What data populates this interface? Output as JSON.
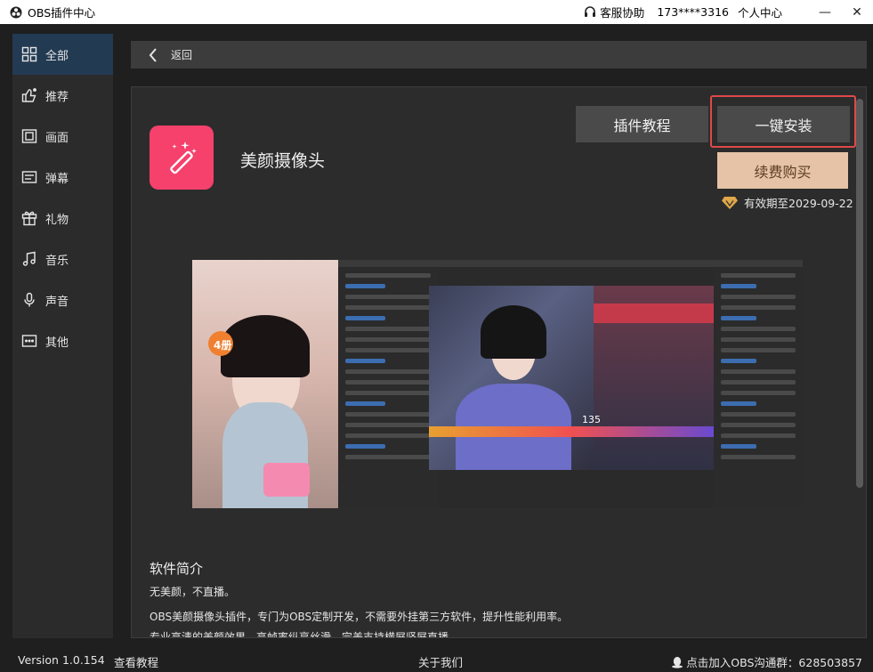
{
  "titlebar": {
    "app_title": "OBS插件中心",
    "support_label": "客服协助",
    "phone": "173****3316",
    "personal_center": "个人中心",
    "minimize": "—",
    "close": "✕"
  },
  "sidebar": {
    "items": [
      {
        "label": "全部",
        "icon": "grid-icon",
        "active": true
      },
      {
        "label": "推荐",
        "icon": "thumbs-up-icon",
        "active": false
      },
      {
        "label": "画面",
        "icon": "picture-frame-icon",
        "active": false
      },
      {
        "label": "弹幕",
        "icon": "barrage-icon",
        "active": false
      },
      {
        "label": "礼物",
        "icon": "gift-icon",
        "active": false
      },
      {
        "label": "音乐",
        "icon": "music-icon",
        "active": false
      },
      {
        "label": "声音",
        "icon": "microphone-icon",
        "active": false
      },
      {
        "label": "其他",
        "icon": "more-icon",
        "active": false
      }
    ]
  },
  "backbar": {
    "back_label": "返回"
  },
  "plugin": {
    "name": "美颜摄像头",
    "tutorial_button": "插件教程",
    "install_button": "一键安装",
    "buy_button": "续费购买",
    "validity": "有效期至2029-09-22"
  },
  "preview": {
    "badge": "4册",
    "counter": "135"
  },
  "description": {
    "title": "软件简介",
    "line1": "无美颜，不直播。",
    "line2": "OBS美颜摄像头插件，专门为OBS定制开发，不需要外挂第三方软件，提升性能利用率。",
    "line3": "专业高清的美颜效果，高帧率纵享丝滑，完美支持横屏竖屏直播。"
  },
  "footer": {
    "version": "Version 1.0.154",
    "tutorial": "查看教程",
    "about": "关于我们",
    "group": "点击加入OBS沟通群：628503857"
  },
  "colors": {
    "accent_active": "#223a52",
    "install_highlight": "#e04848",
    "app_icon_bg": "#f5416c",
    "buy_button_bg": "#e6c3a6",
    "diamond": "#e0a64a"
  }
}
